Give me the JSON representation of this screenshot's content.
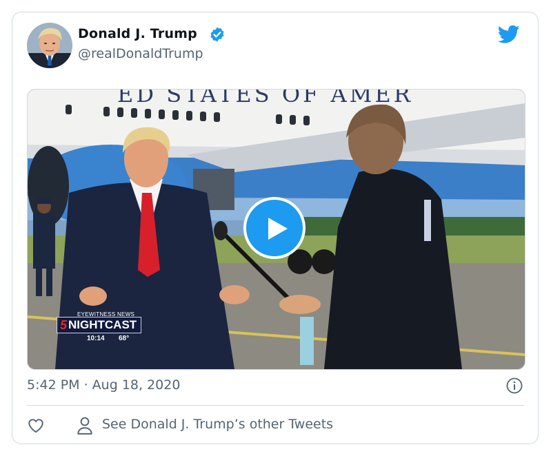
{
  "tweet": {
    "author_name": "Donald J. Trump",
    "author_handle": "@realDonaldTrump",
    "verified": true,
    "timestamp": "5:42 PM · Aug 18, 2020",
    "other_tweets_link": "See Donald J. Trump’s other Tweets"
  },
  "media": {
    "type": "video",
    "plane_text": "ED STATES OF AMER",
    "news_logo": {
      "network_line": "EYEWITNESS NEWS",
      "channel": "5",
      "show": "NIGHTCAST",
      "time": "10:14",
      "temperature": "68°"
    }
  },
  "icons": {
    "verified": "verified-badge-icon",
    "twitter": "twitter-bird-icon",
    "play": "play-icon",
    "info": "info-icon",
    "like": "heart-icon",
    "profile": "person-icon"
  },
  "colors": {
    "twitter_blue": "#1d9bf0",
    "text_secondary": "#536471",
    "border": "#cfd9de"
  }
}
